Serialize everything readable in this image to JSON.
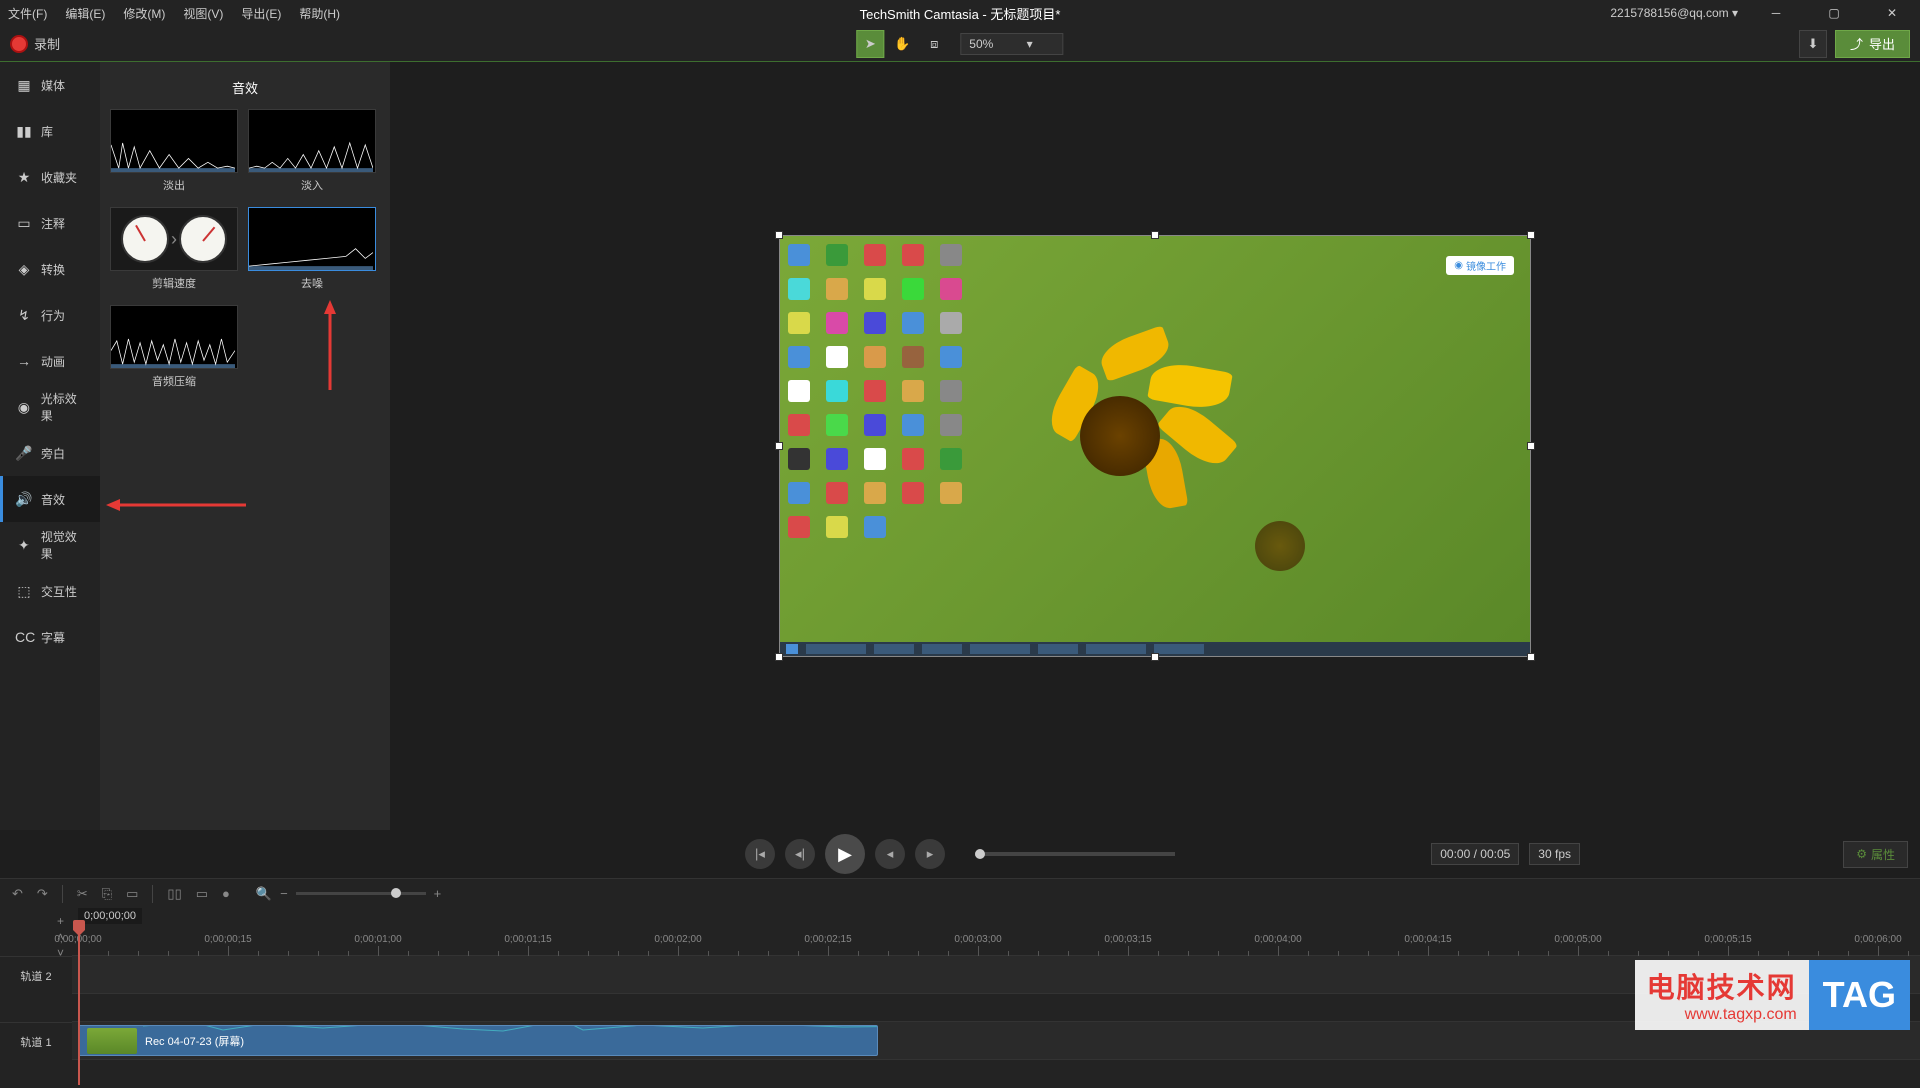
{
  "title": "TechSmith Camtasia - 无标题项目*",
  "account": "2215788156@qq.com ▾",
  "menu": [
    "文件(F)",
    "编辑(E)",
    "修改(M)",
    "视图(V)",
    "导出(E)",
    "帮助(H)"
  ],
  "record_label": "录制",
  "zoom": "50%",
  "export_label": "导出",
  "sidebar": {
    "items": [
      {
        "icon": "▦",
        "label": "媒体"
      },
      {
        "icon": "▮▮",
        "label": "库"
      },
      {
        "icon": "★",
        "label": "收藏夹"
      },
      {
        "icon": "▭",
        "label": "注释"
      },
      {
        "icon": "◈",
        "label": "转换"
      },
      {
        "icon": "↯",
        "label": "行为"
      },
      {
        "icon": "→",
        "label": "动画"
      },
      {
        "icon": "◉",
        "label": "光标效果"
      },
      {
        "icon": "🎤",
        "label": "旁白"
      },
      {
        "icon": "🔊",
        "label": "音效"
      },
      {
        "icon": "✦",
        "label": "视觉效果"
      },
      {
        "icon": "⬚",
        "label": "交互性"
      },
      {
        "icon": "CC",
        "label": "字幕"
      }
    ],
    "active_index": 9
  },
  "panel": {
    "title": "音效",
    "effects": [
      "淡出",
      "淡入",
      "剪辑速度",
      "去噪",
      "音频压缩"
    ]
  },
  "playback": {
    "time": "00:00 / 00:05",
    "fps": "30 fps",
    "properties": "属性"
  },
  "timeline": {
    "playhead": "0;00;00;00",
    "ruler": [
      "0;00;00;00",
      "0;00;00;15",
      "0;00;01;00",
      "0;00;01;15",
      "0;00;02;00",
      "0;00;02;15",
      "0;00;03;00",
      "0;00;03;15",
      "0;00;04;00",
      "0;00;04;15",
      "0;00;05;00",
      "0;00;05;15",
      "0;00;06;00"
    ],
    "tracks": [
      "轨道 2",
      "轨道 1"
    ],
    "clip_name": "Rec 04-07-23 (屏幕)"
  },
  "watermark": {
    "cn": "电脑技术网",
    "url": "www.tagxp.com",
    "tag": "TAG"
  },
  "canvas_badge": "镜像工作"
}
